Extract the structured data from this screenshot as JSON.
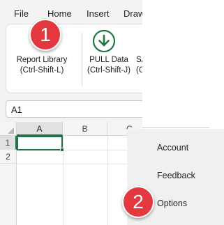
{
  "menu": {
    "tabs": [
      "File",
      "Home",
      "Insert",
      "Draw"
    ]
  },
  "ribbon": {
    "report_library": {
      "line1": "Report Library",
      "line2": "(Ctrl-Shift-L)"
    },
    "pull_data": {
      "line1": "PULL Data",
      "line2": "(Ctrl-Shift-J)",
      "icon": "download-circle-icon"
    },
    "third": {
      "line1": "SA",
      "line2": "(Ctr"
    }
  },
  "name_box": {
    "value": "A1"
  },
  "grid": {
    "columns": [
      "A",
      "B",
      "C"
    ],
    "rows": [
      "1",
      "2"
    ],
    "active_cell": "A1"
  },
  "backstage": {
    "items": [
      "Account",
      "Feedback",
      "Options"
    ]
  },
  "callouts": [
    "1",
    "2"
  ],
  "colors": {
    "callout_red": "#e3383f",
    "excel_green": "#217346",
    "download_icon_green": "#1f7a3e"
  }
}
